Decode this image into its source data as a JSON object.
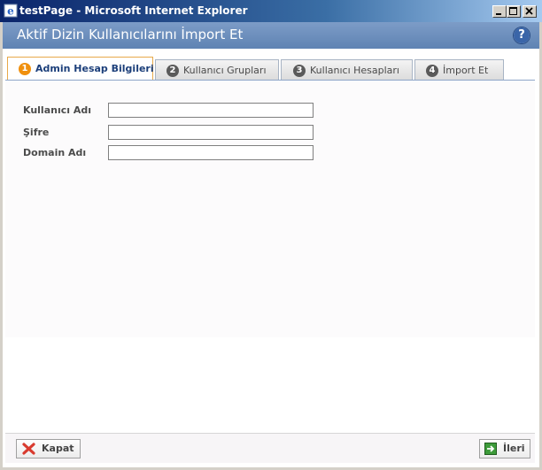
{
  "window": {
    "title": "testPage - Microsoft Internet Explorer"
  },
  "header": {
    "title": "Aktif Dizin Kullanıcılarını İmport Et",
    "help_label": "?"
  },
  "tabs": [
    {
      "number": "1",
      "label": "Admin Hesap Bilgileri",
      "active": true
    },
    {
      "number": "2",
      "label": "Kullanıcı Grupları",
      "active": false
    },
    {
      "number": "3",
      "label": "Kullanıcı Hesapları",
      "active": false
    },
    {
      "number": "4",
      "label": "İmport Et",
      "active": false
    }
  ],
  "form": {
    "fields": [
      {
        "label": "Kullanıcı Adı",
        "value": ""
      },
      {
        "label": "Şifre",
        "value": ""
      },
      {
        "label": "Domain Adı",
        "value": ""
      }
    ]
  },
  "footer": {
    "close_label": "Kapat",
    "next_label": "İleri"
  },
  "colors": {
    "header_bg": "#6e90bd",
    "active_tab_accent": "#f0900e",
    "titlebar": "#0a246a"
  }
}
